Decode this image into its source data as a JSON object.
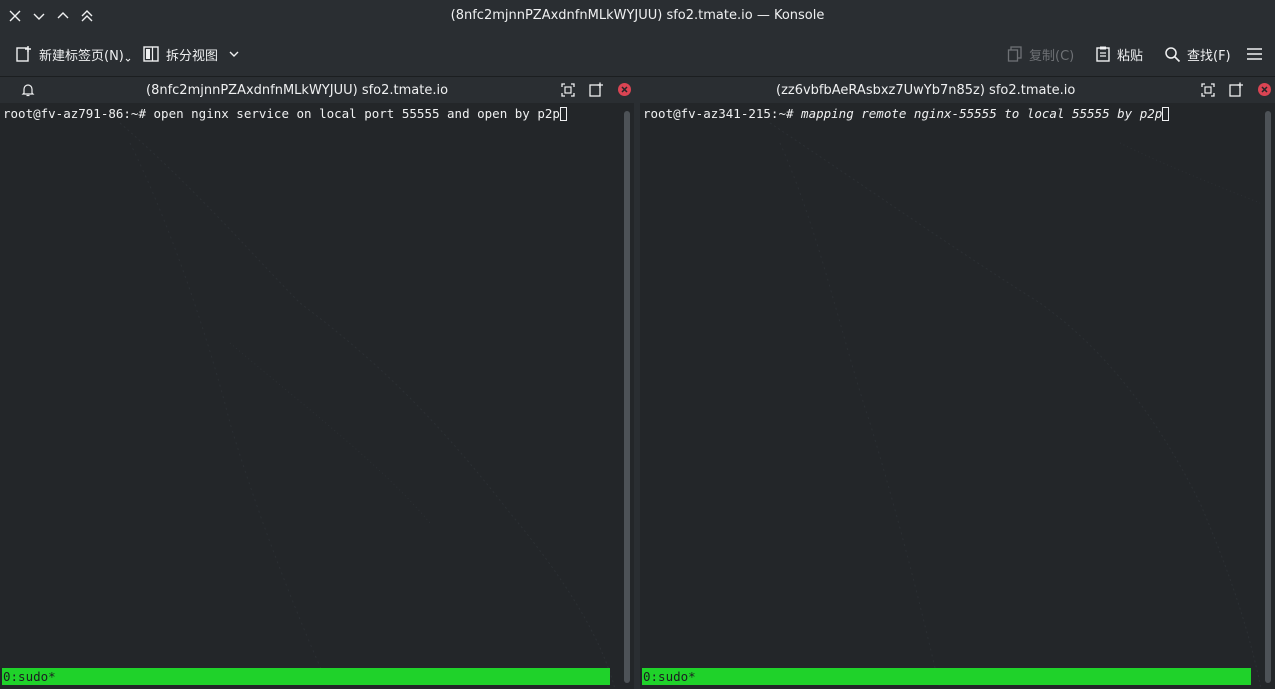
{
  "window": {
    "title": "(8nfc2mjnnPZAxdnfnMLkWYJUU) sfo2.tmate.io — Konsole"
  },
  "toolbar": {
    "new_tab_label": "新建标签页(N)",
    "split_view_label": "拆分视图",
    "copy_label": "复制(C)",
    "paste_label": "粘贴",
    "find_label": "查找(F)"
  },
  "panes": [
    {
      "title": "(8nfc2mjnnPZAxdnfnMLkWYJUU) sfo2.tmate.io",
      "prompt": "root@fv-az791-86:~# ",
      "command": "open nginx service on local port 55555 and open by p2p",
      "status": "0:sudo*"
    },
    {
      "title": "(zz6vbfbAeRAsbxz7UwYb7n85z) sfo2.tmate.io",
      "prompt": "root@fv-az341-215:~# ",
      "command": "mapping remote nginx-55555 to local 55555 by p2p",
      "status": "0:sudo*"
    }
  ],
  "colors": {
    "background": "#232629",
    "chrome": "#2a2e32",
    "status_bar": "#1fd22a",
    "close_button": "#da4453",
    "text": "#eff0f1"
  },
  "icons": [
    "close-icon",
    "minimize-icon",
    "maximize-icon",
    "keep-above-icon",
    "new-tab-icon",
    "split-view-icon",
    "chevron-down-icon",
    "copy-icon",
    "paste-icon",
    "search-icon",
    "hamburger-menu-icon",
    "bell-icon",
    "expand-icon",
    "new-window-icon"
  ]
}
